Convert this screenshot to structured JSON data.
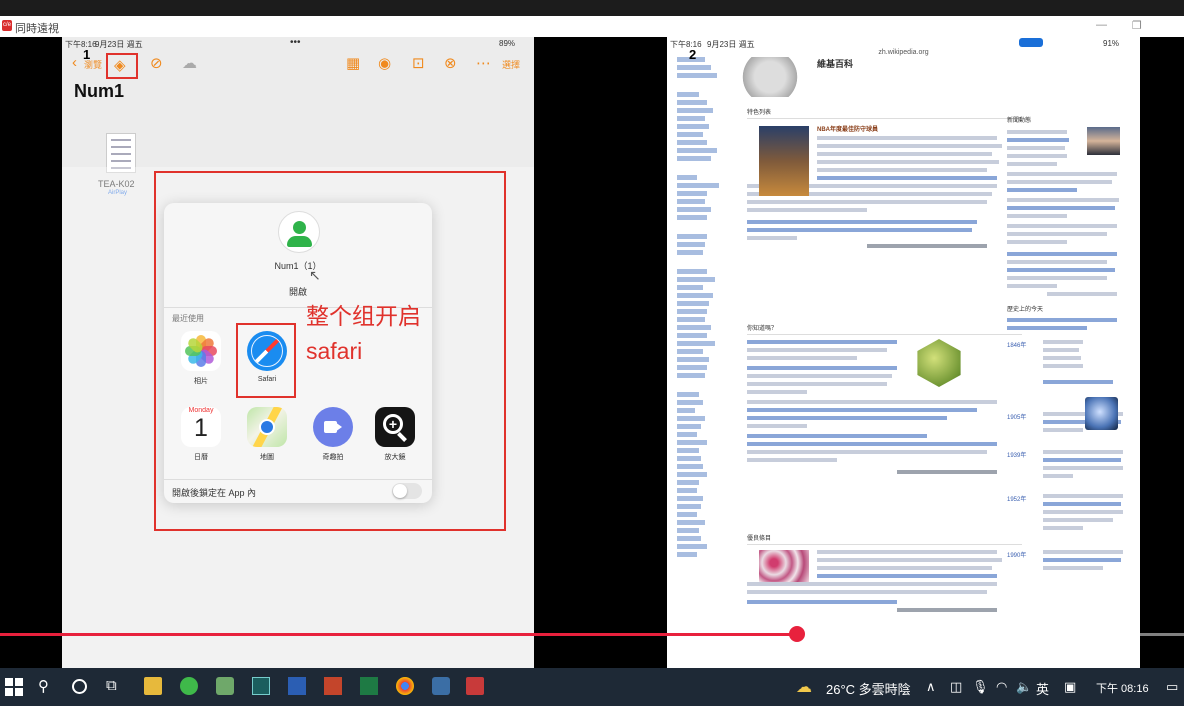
{
  "window": {
    "title": "同時遠視",
    "logo": "c/e"
  },
  "left_ipad": {
    "status_time": "下午8:16",
    "status_date": "9月23日 週五",
    "status_dots": "•••",
    "status_right": "89%",
    "back_label": "瀏覽",
    "select_label": "選擇",
    "doc_title": "Num1",
    "file": {
      "name": "TEA-K02",
      "tag": "AirPlay"
    },
    "popup": {
      "doc_name": "Num1（1）",
      "open_label": "開啟",
      "recent_label": "最近使用",
      "lock_label": "開啟後鎖定在 App 內"
    },
    "apps": [
      {
        "name": "相片",
        "icon": "photos-icon"
      },
      {
        "name": "Safari",
        "icon": "safari-icon"
      },
      {
        "name": "日曆",
        "icon": "calendar-icon",
        "weekday": "Monday",
        "day": "1"
      },
      {
        "name": "地圖",
        "icon": "maps-icon"
      },
      {
        "name": "奇趣拍",
        "icon": "facetime-icon"
      },
      {
        "name": "放大鏡",
        "icon": "magnifier-icon"
      }
    ]
  },
  "annotation": {
    "line1": "整个组开启",
    "line2": "safari",
    "color": "#e0322c"
  },
  "screen_labels": {
    "one": "1",
    "two": "2"
  },
  "right_ipad": {
    "status_time": "下午8:16",
    "status_date": "9月23日 週五",
    "status_right": "91%",
    "url": "zh.wikipedia.org",
    "site_title": "維基百科",
    "featured_header": "特色列表",
    "featured_title": "NBA年度最佳防守球員",
    "did_you_know": "你知道嗎？",
    "good_article": "優良條目",
    "news_header": "新聞動態",
    "history_header": "歷史上的今天",
    "years": [
      "1846年",
      "1905年",
      "1939年",
      "1952年",
      "1990年"
    ]
  },
  "taskbar": {
    "weather": "26°C 多雲時陰",
    "ime": "英",
    "time": "下午 08:16"
  },
  "progress": {
    "played_fraction": 0.672
  },
  "colors": {
    "accent_red": "#e0322c",
    "progress": "#e8213d",
    "ios_orange": "#f08a1e"
  }
}
